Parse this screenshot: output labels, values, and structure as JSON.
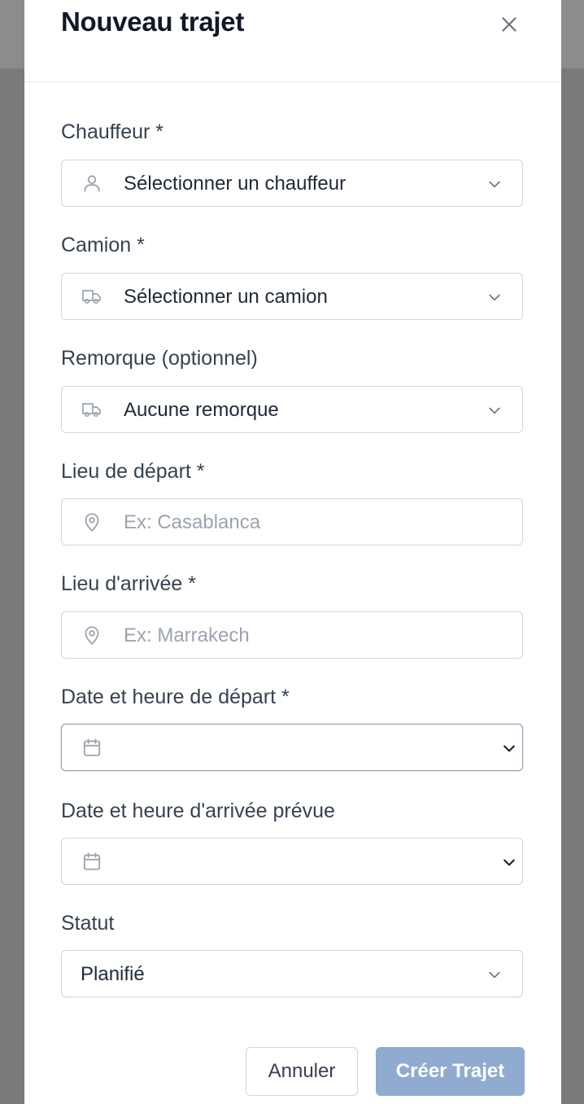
{
  "modal": {
    "title": "Nouveau trajet",
    "close_icon": "close-icon"
  },
  "fields": {
    "chauffeur": {
      "label": "Chauffeur *",
      "value": "Sélectionner un chauffeur",
      "icon": "user-icon"
    },
    "camion": {
      "label": "Camion *",
      "value": "Sélectionner un camion",
      "icon": "truck-icon"
    },
    "remorque": {
      "label": "Remorque (optionnel)",
      "value": "Aucune remorque",
      "icon": "truck-icon"
    },
    "depart": {
      "label": "Lieu de départ *",
      "placeholder": "Ex: Casablanca",
      "value": "",
      "icon": "map-pin-icon"
    },
    "arrivee": {
      "label": "Lieu d'arrivée *",
      "placeholder": "Ex: Marrakech",
      "value": "",
      "icon": "map-pin-icon"
    },
    "date_depart": {
      "label": "Date et heure de départ *",
      "value": "",
      "icon": "calendar-icon"
    },
    "date_arrivee": {
      "label": "Date et heure d'arrivée prévue",
      "value": "",
      "icon": "calendar-icon"
    },
    "statut": {
      "label": "Statut",
      "value": "Planifié"
    }
  },
  "actions": {
    "cancel_label": "Annuler",
    "create_label": "Créer Trajet"
  },
  "colors": {
    "primary_button": "#8fabcf",
    "text": "#111827",
    "border": "#d1d5db",
    "placeholder": "#9ca3af"
  }
}
